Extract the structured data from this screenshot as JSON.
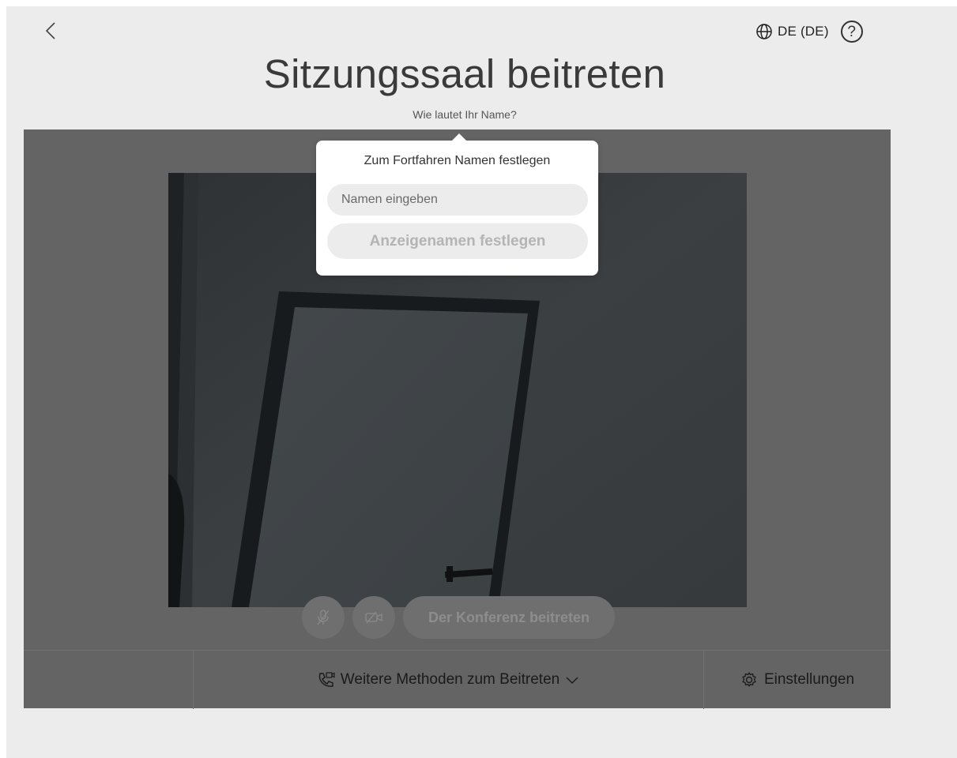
{
  "header": {
    "back_icon": "chevron-left-icon",
    "language_icon": "globe-icon",
    "language_label": "DE (DE)",
    "help_symbol": "?"
  },
  "main": {
    "title": "Sitzungssaal beitreten",
    "subtitle": "Wie lautet Ihr Name?"
  },
  "name_popover": {
    "title": "Zum Fortfahren Namen festlegen",
    "input_placeholder": "Namen eingeben",
    "input_value": "",
    "submit_label": "Anzeigenamen festlegen"
  },
  "controls": {
    "mute_icon": "microphone-muted-icon",
    "video_icon": "camera-off-icon",
    "join_label": "Der Konferenz beitreten"
  },
  "bottom_bar": {
    "more_methods_label": "Weitere Methoden zum Beitreten",
    "more_methods_icon": "phone-video-icon",
    "settings_label": "Einstellungen",
    "settings_icon": "gear-icon"
  },
  "colors": {
    "page_bg": "#ececec",
    "stage_bg": "#646464",
    "disabled_text": "#b4b4b4"
  }
}
